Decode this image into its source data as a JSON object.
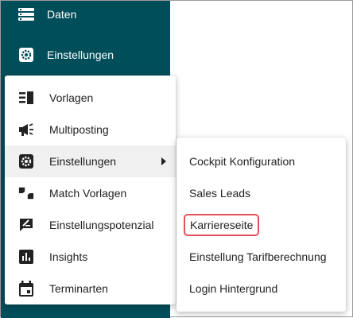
{
  "sidebar": {
    "items": [
      {
        "label": "Daten",
        "icon": "list-icon"
      },
      {
        "label": "Einstellungen",
        "icon": "gear-icon"
      }
    ]
  },
  "menu": {
    "items": [
      {
        "label": "Vorlagen",
        "icon": "template-icon"
      },
      {
        "label": "Multiposting",
        "icon": "megaphone-icon"
      },
      {
        "label": "Einstellungen",
        "icon": "gear-icon",
        "has_submenu": true
      },
      {
        "label": "Match Vorlagen",
        "icon": "thumbs-icon"
      },
      {
        "label": "Einstellungspotenzial",
        "icon": "edit-icon"
      },
      {
        "label": "Insights",
        "icon": "bar-chart-icon"
      },
      {
        "label": "Terminarten",
        "icon": "calendar-icon"
      }
    ]
  },
  "submenu": {
    "items": [
      {
        "label": "Cockpit Konfiguration"
      },
      {
        "label": "Sales Leads"
      },
      {
        "label": "Karriereseite",
        "highlighted": true
      },
      {
        "label": "Einstellung Tarifberechnung"
      },
      {
        "label": "Login Hintergrund"
      }
    ]
  },
  "colors": {
    "sidebar_bg": "#004e5a",
    "highlight_border": "#e0525a",
    "hover_bg": "#f0f0f0"
  }
}
